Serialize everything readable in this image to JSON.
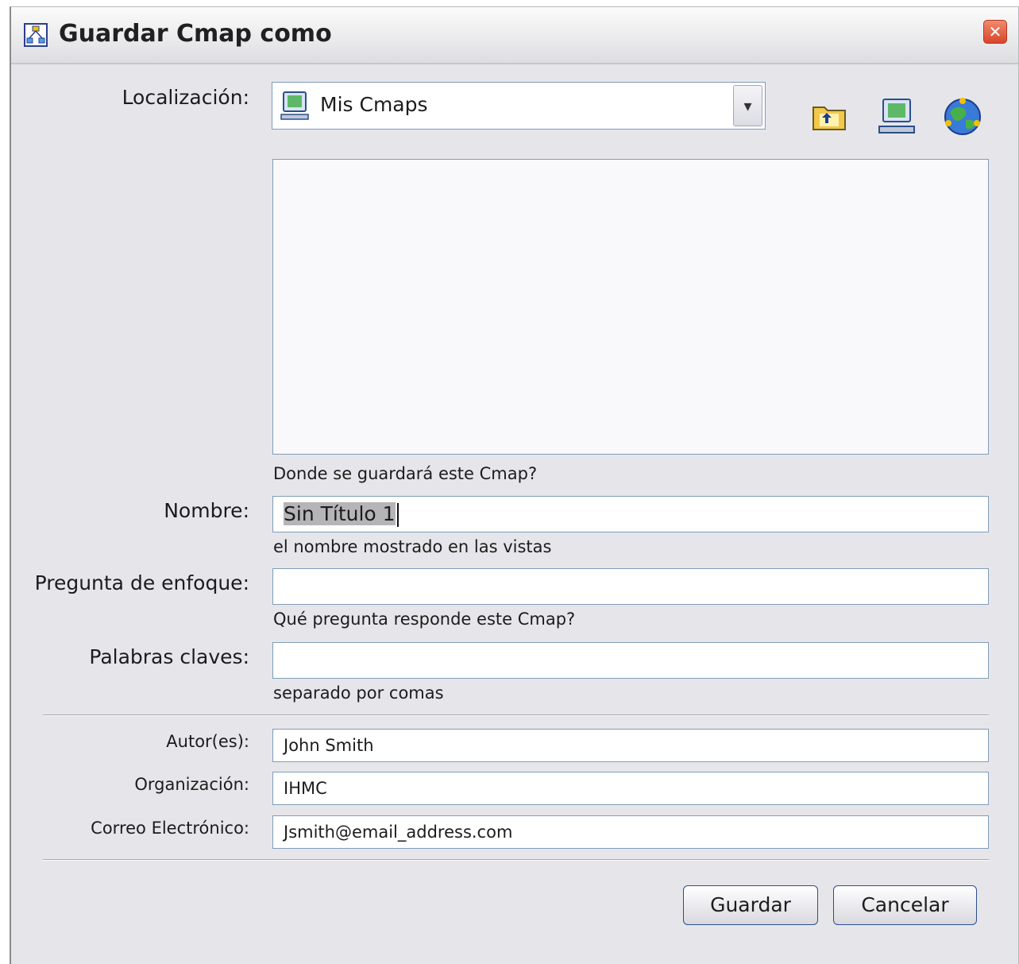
{
  "window": {
    "title": "Guardar Cmap como",
    "icon": "cmap-app-icon",
    "close_icon": "close-icon"
  },
  "location": {
    "label": "Localización:",
    "value": "Mis Cmaps",
    "value_icon": "computer-icon",
    "toolbar": [
      {
        "name": "folder-up-icon"
      },
      {
        "name": "my-cmaps-computer-icon"
      },
      {
        "name": "shared-places-globe-icon"
      }
    ]
  },
  "browser": {
    "hint": "Donde se guardará este Cmap?"
  },
  "name": {
    "label": "Nombre:",
    "value": "Sin Título 1",
    "hint": "el nombre mostrado en las vistas"
  },
  "focus_question": {
    "label": "Pregunta de enfoque:",
    "value": "",
    "hint": "Qué pregunta responde este Cmap?"
  },
  "keywords": {
    "label": "Palabras claves:",
    "value": "",
    "hint": "separado por comas"
  },
  "author": {
    "label": "Autor(es):",
    "value": "John Smith"
  },
  "organization": {
    "label": "Organización:",
    "value": "IHMC"
  },
  "email": {
    "label": "Correo Electrónico:",
    "value": "Jsmith@email_address.com"
  },
  "buttons": {
    "save": "Guardar",
    "cancel": "Cancelar"
  }
}
